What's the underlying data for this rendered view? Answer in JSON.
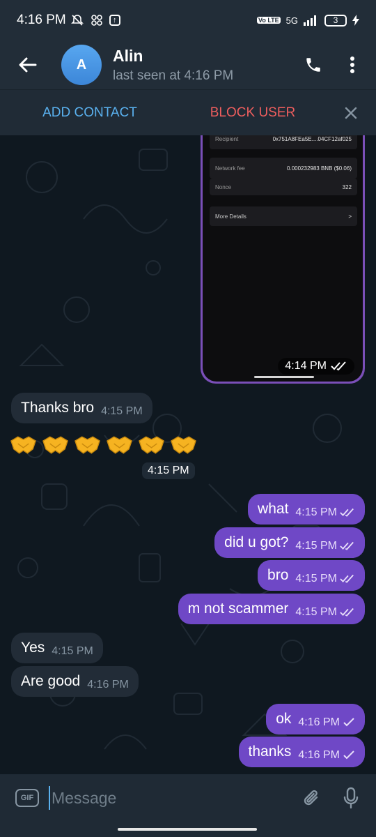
{
  "status_bar": {
    "time": "4:16 PM",
    "network": "5G",
    "volte": "Vo LTE",
    "battery": "3"
  },
  "header": {
    "back_icon": "back-arrow-icon",
    "avatar_letter": "A",
    "name": "Alin",
    "status": "last seen at 4:16 PM"
  },
  "action_bar": {
    "add_contact": "ADD CONTACT",
    "block_user": "BLOCK USER"
  },
  "photo": {
    "rows": [
      {
        "label": "Recipient",
        "value": "0x751A8FEa5E....04CF12af025"
      },
      {
        "label": "Network fee",
        "value": "0.000232983 BNB ($0.06)"
      },
      {
        "label": "Nonce",
        "value": "322"
      },
      {
        "label": "More Details",
        "value": ">"
      }
    ],
    "time": "4:14 PM"
  },
  "messages": [
    {
      "dir": "in",
      "text": "Thanks bro",
      "time": "4:15 PM"
    },
    {
      "dir": "in",
      "emoji": "handshake x6",
      "time": "4:15 PM"
    },
    {
      "dir": "out",
      "text": "what",
      "time": "4:15 PM",
      "read": true
    },
    {
      "dir": "out",
      "text": "did u got?",
      "time": "4:15 PM",
      "read": true
    },
    {
      "dir": "out",
      "text": "bro",
      "time": "4:15 PM",
      "read": true
    },
    {
      "dir": "out",
      "text": "m not scammer",
      "time": "4:15 PM",
      "read": true
    },
    {
      "dir": "in",
      "text": "Yes",
      "time": "4:15 PM"
    },
    {
      "dir": "in",
      "text": "Are good",
      "time": "4:16 PM"
    },
    {
      "dir": "out",
      "text": "ok",
      "time": "4:16 PM",
      "read": false
    },
    {
      "dir": "out",
      "text": "thanks",
      "time": "4:16 PM",
      "read": false
    }
  ],
  "input": {
    "gif_label": "GIF",
    "placeholder": "Message"
  },
  "colors": {
    "outgoing_bubble": "#6f48c6",
    "incoming_bubble": "#222c37",
    "accent_blue": "#5ab1ef",
    "block_red": "#ef5e5e"
  }
}
